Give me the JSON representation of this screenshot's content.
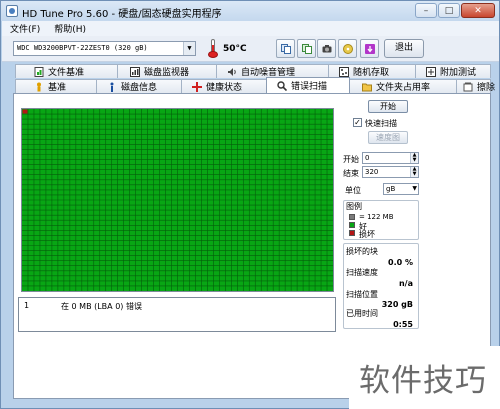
{
  "window": {
    "title": "HD Tune Pro 5.60 - 硬盘/固态硬盘实用程序"
  },
  "window_buttons": {
    "minimize": "–",
    "maximize": "□",
    "close": "✕"
  },
  "menu": {
    "items": [
      "文件(F)",
      "帮助(H)"
    ]
  },
  "toolbar": {
    "drive": "WDC WD3200BPVT-22ZEST0 (320 gB)",
    "temperature": "50°C",
    "exit_label": "退出",
    "buttons": [
      "copy-info-icon",
      "copy-screen-icon",
      "camera-icon",
      "cd-icon",
      "download-icon"
    ]
  },
  "tabs": {
    "row1": [
      {
        "label": "文件基准",
        "icon": "file-benchmark-icon"
      },
      {
        "label": "磁盘监视器",
        "icon": "disk-monitor-icon"
      },
      {
        "label": "自动噪音管理",
        "icon": "speaker-icon"
      },
      {
        "label": "随机存取",
        "icon": "random-access-icon"
      },
      {
        "label": "附加测试",
        "icon": "extra-tests-icon"
      }
    ],
    "row2": [
      {
        "label": "基准",
        "icon": "benchmark-icon"
      },
      {
        "label": "磁盘信息",
        "icon": "info-icon"
      },
      {
        "label": "健康状态",
        "icon": "health-icon"
      },
      {
        "label": "错误扫描",
        "icon": "error-scan-icon",
        "active": true
      },
      {
        "label": "文件夹占用率",
        "icon": "folder-icon"
      },
      {
        "label": "擦除",
        "icon": "erase-icon"
      }
    ]
  },
  "scan": {
    "start_button": "开始",
    "quick_scan_label": "快速扫描",
    "quick_scan_checked": true,
    "speed_map_button": "速度图",
    "start_label": "开始",
    "start_value": "0",
    "end_label": "结束",
    "end_value": "320",
    "unit_label": "单位",
    "unit_value": "gB",
    "legend_title": "图例",
    "legend_block": "= 122 MB",
    "legend_good": "好",
    "legend_bad": "损坏",
    "colors": {
      "good": "#08a614",
      "bad": "#b31616",
      "block": "#7a7a7a"
    },
    "damaged_blocks_label": "损坏的块",
    "damaged_blocks_value": "0.0 %",
    "scan_speed_label": "扫描速度",
    "scan_speed_value": "n/a",
    "scan_position_label": "扫描位置",
    "scan_position_value": "320 gB",
    "elapsed_label": "已用时间",
    "elapsed_value": "0:55"
  },
  "log": {
    "entries": [
      {
        "num": "1",
        "text": "在 0 MB (LBA 0) 错误"
      }
    ]
  },
  "watermark": {
    "text": "软件技巧"
  }
}
